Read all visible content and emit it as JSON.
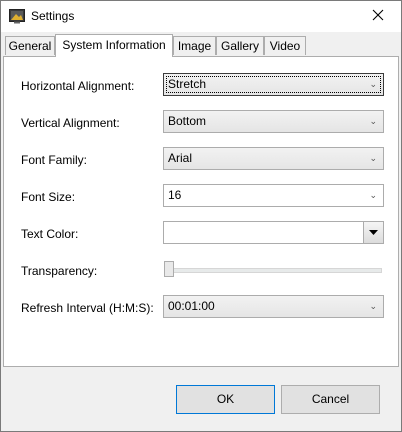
{
  "window": {
    "title": "Settings"
  },
  "tabs": [
    {
      "label": "General",
      "active": false
    },
    {
      "label": "System Information",
      "active": true
    },
    {
      "label": "Image",
      "active": false
    },
    {
      "label": "Gallery",
      "active": false
    },
    {
      "label": "Video",
      "active": false
    }
  ],
  "form": {
    "horizontal_alignment": {
      "label": "Horizontal Alignment:",
      "value": "Stretch"
    },
    "vertical_alignment": {
      "label": "Vertical Alignment:",
      "value": "Bottom"
    },
    "font_family": {
      "label": "Font Family:",
      "value": "Arial"
    },
    "font_size": {
      "label": "Font Size:",
      "value": "16"
    },
    "text_color": {
      "label": "Text Color:",
      "value": ""
    },
    "transparency": {
      "label": "Transparency:",
      "value": 0
    },
    "refresh_interval": {
      "label": "Refresh Interval (H:M:S):",
      "value": "00:01:00"
    }
  },
  "buttons": {
    "ok": "OK",
    "cancel": "Cancel"
  },
  "colors": {
    "default_button_border": "#0078d7",
    "panel_background": "#ffffff",
    "window_background": "#f0f0f0"
  }
}
